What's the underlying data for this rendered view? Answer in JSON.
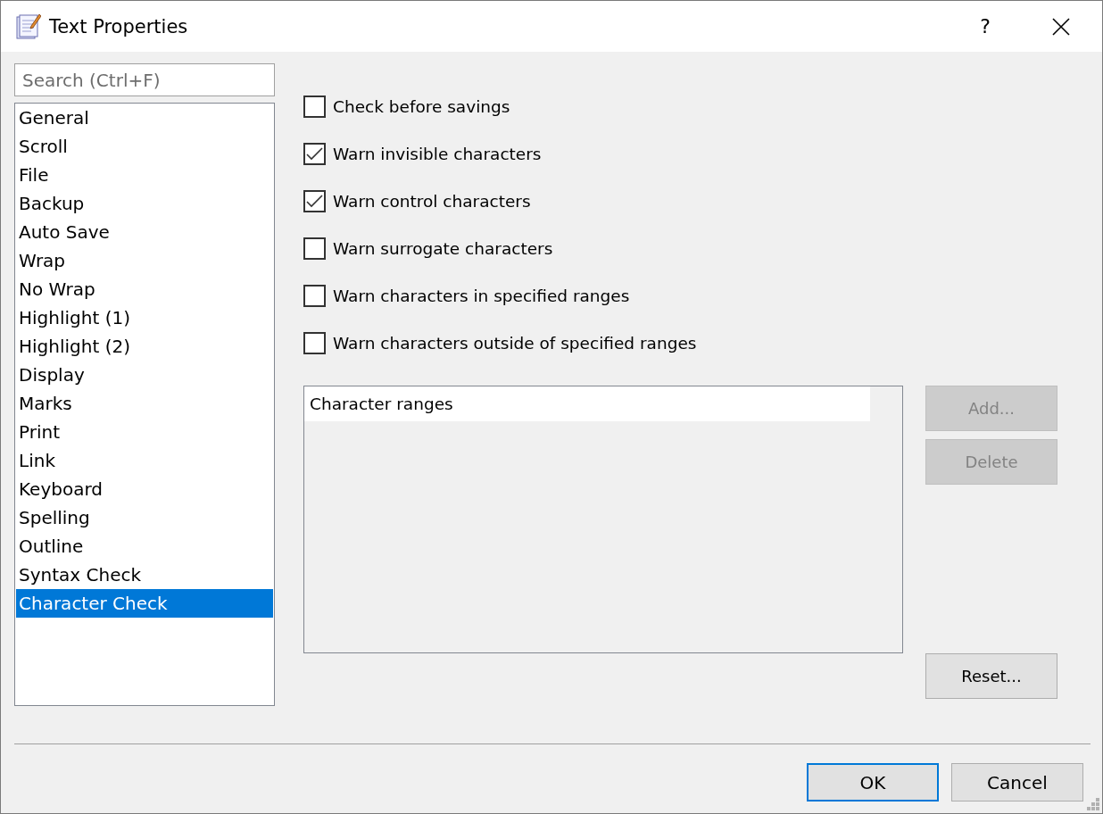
{
  "window": {
    "title": "Text Properties",
    "help": "?"
  },
  "search": {
    "placeholder": "Search (Ctrl+F)"
  },
  "categories": [
    {
      "label": "General",
      "selected": false
    },
    {
      "label": "Scroll",
      "selected": false
    },
    {
      "label": "File",
      "selected": false
    },
    {
      "label": "Backup",
      "selected": false
    },
    {
      "label": "Auto Save",
      "selected": false
    },
    {
      "label": "Wrap",
      "selected": false
    },
    {
      "label": "No Wrap",
      "selected": false
    },
    {
      "label": "Highlight (1)",
      "selected": false
    },
    {
      "label": "Highlight (2)",
      "selected": false
    },
    {
      "label": "Display",
      "selected": false
    },
    {
      "label": "Marks",
      "selected": false
    },
    {
      "label": "Print",
      "selected": false
    },
    {
      "label": "Link",
      "selected": false
    },
    {
      "label": "Keyboard",
      "selected": false
    },
    {
      "label": "Spelling",
      "selected": false
    },
    {
      "label": "Outline",
      "selected": false
    },
    {
      "label": "Syntax Check",
      "selected": false
    },
    {
      "label": "Character Check",
      "selected": true
    }
  ],
  "options": [
    {
      "label": "Check before savings",
      "checked": false
    },
    {
      "label": "Warn invisible characters",
      "checked": true
    },
    {
      "label": "Warn control characters",
      "checked": true
    },
    {
      "label": "Warn surrogate characters",
      "checked": false
    },
    {
      "label": "Warn characters in specified ranges",
      "checked": false
    },
    {
      "label": "Warn characters outside of specified ranges",
      "checked": false
    }
  ],
  "ranges_list": {
    "column": "Character ranges"
  },
  "list_buttons": [
    {
      "label": "Add...",
      "disabled": true
    },
    {
      "label": "Delete",
      "disabled": true
    }
  ],
  "reset_button": {
    "label": "Reset...",
    "disabled": false
  },
  "dialog_buttons": [
    {
      "label": "OK",
      "default": true
    },
    {
      "label": "Cancel",
      "default": false
    }
  ]
}
